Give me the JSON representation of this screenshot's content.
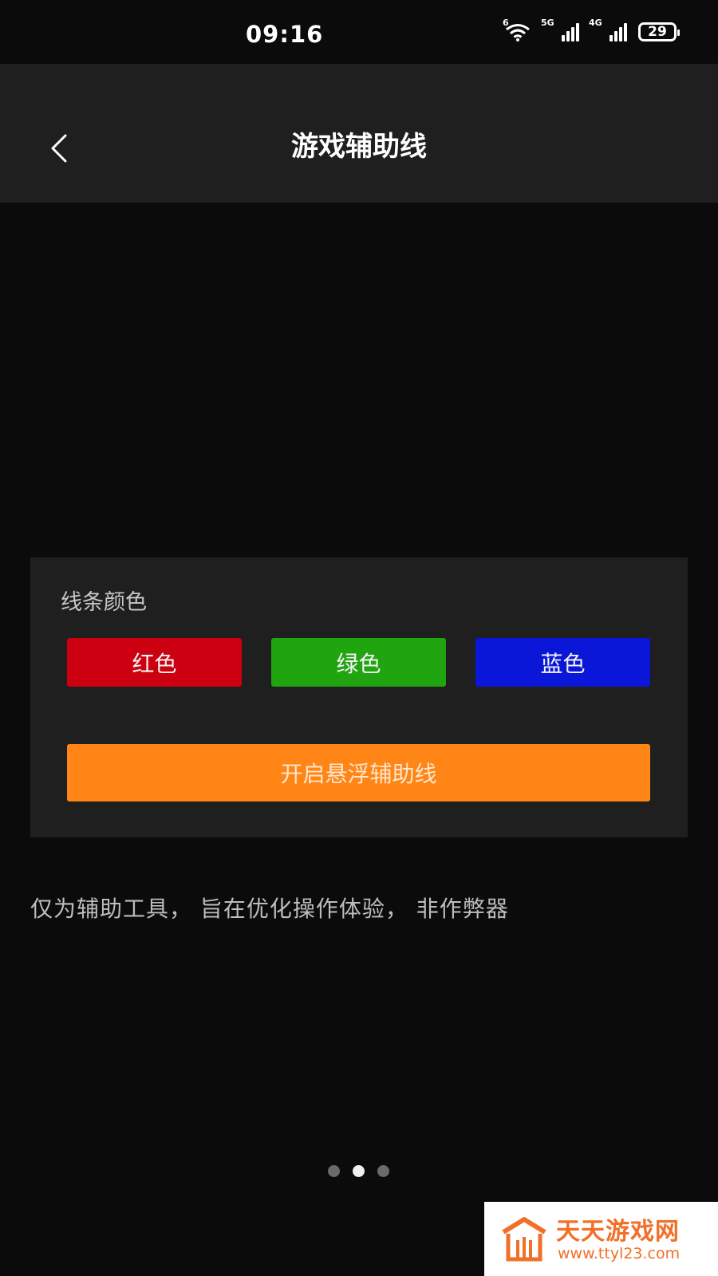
{
  "status_bar": {
    "time": "09:16",
    "wifi_label": "6",
    "signal1_label": "5G",
    "signal2_label": "4G",
    "battery": "29"
  },
  "header": {
    "title": "游戏辅助线",
    "back_icon": "chevron-left-icon"
  },
  "card": {
    "label": "线条颜色",
    "colors": [
      {
        "label": "红色",
        "color": "#cc0010"
      },
      {
        "label": "绿色",
        "color": "#20a410"
      },
      {
        "label": "蓝色",
        "color": "#0a16d8"
      }
    ],
    "toggle_label": "开启悬浮辅助线",
    "toggle_color": "#ff8516"
  },
  "disclaimer": "仅为辅助工具， 旨在优化操作体验， 非作弊器",
  "pager": {
    "count": 3,
    "active_index": 1
  },
  "watermark": {
    "name": "天天游戏网",
    "url": "www.ttyl23.com"
  }
}
